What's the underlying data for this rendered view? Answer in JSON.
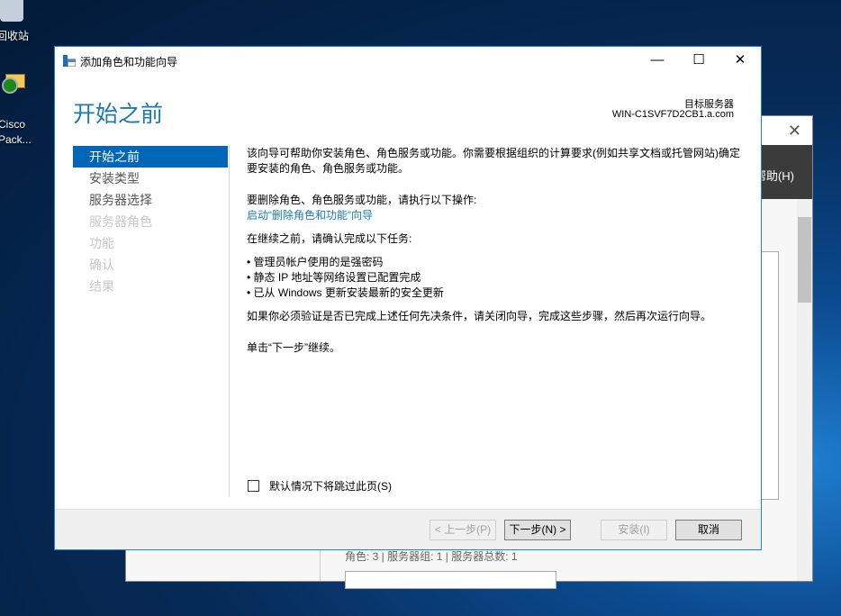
{
  "desktop": {
    "icons": [
      {
        "label": "回收站",
        "icon": "recycle-bin-icon"
      },
      {
        "label": "Cisco Pack...",
        "icon": "cisco-packet-tracer-icon"
      }
    ]
  },
  "background_window": {
    "menu_help": "帮助(H)",
    "status": "角色: 3 | 服务器组: 1 | 服务器总数: 1"
  },
  "wizard": {
    "title": "添加角色和功能向导",
    "header": "开始之前",
    "target_label": "目标服务器",
    "target_server": "WIN-C1SVF7D2CB1.a.com",
    "nav": [
      {
        "label": "开始之前",
        "state": "active"
      },
      {
        "label": "安装类型",
        "state": "enabled"
      },
      {
        "label": "服务器选择",
        "state": "enabled"
      },
      {
        "label": "服务器角色",
        "state": "disabled"
      },
      {
        "label": "功能",
        "state": "disabled"
      },
      {
        "label": "确认",
        "state": "disabled"
      },
      {
        "label": "结果",
        "state": "disabled"
      }
    ],
    "content": {
      "intro": "该向导可帮助你安装角色、角色服务或功能。你需要根据组织的计算要求(例如共享文档或托管网站)确定要安装的角色、角色服务或功能。",
      "remove_text": "要删除角色、角色服务或功能，请执行以下操作:",
      "remove_link": "启动“删除角色和功能”向导",
      "before_text": "在继续之前，请确认完成以下任务:",
      "tasks": [
        "管理员帐户使用的是强密码",
        "静态 IP 地址等网络设置已配置完成",
        "已从 Windows 更新安装最新的安全更新"
      ],
      "verify_text": "如果你必须验证是否已完成上述任何先决条件，请关闭向导，完成这些步骤，然后再次运行向导。",
      "continue_text": "单击“下一步”继续。"
    },
    "skip_checkbox": {
      "label": "默认情况下将跳过此页(S)",
      "checked": false
    },
    "buttons": {
      "prev": "< 上一步(P)",
      "next": "下一步(N) >",
      "install": "安装(I)",
      "cancel": "取消"
    },
    "controls": {
      "minimize": "—",
      "maximize": "☐",
      "close": "✕"
    },
    "accent": "#0067b8"
  }
}
